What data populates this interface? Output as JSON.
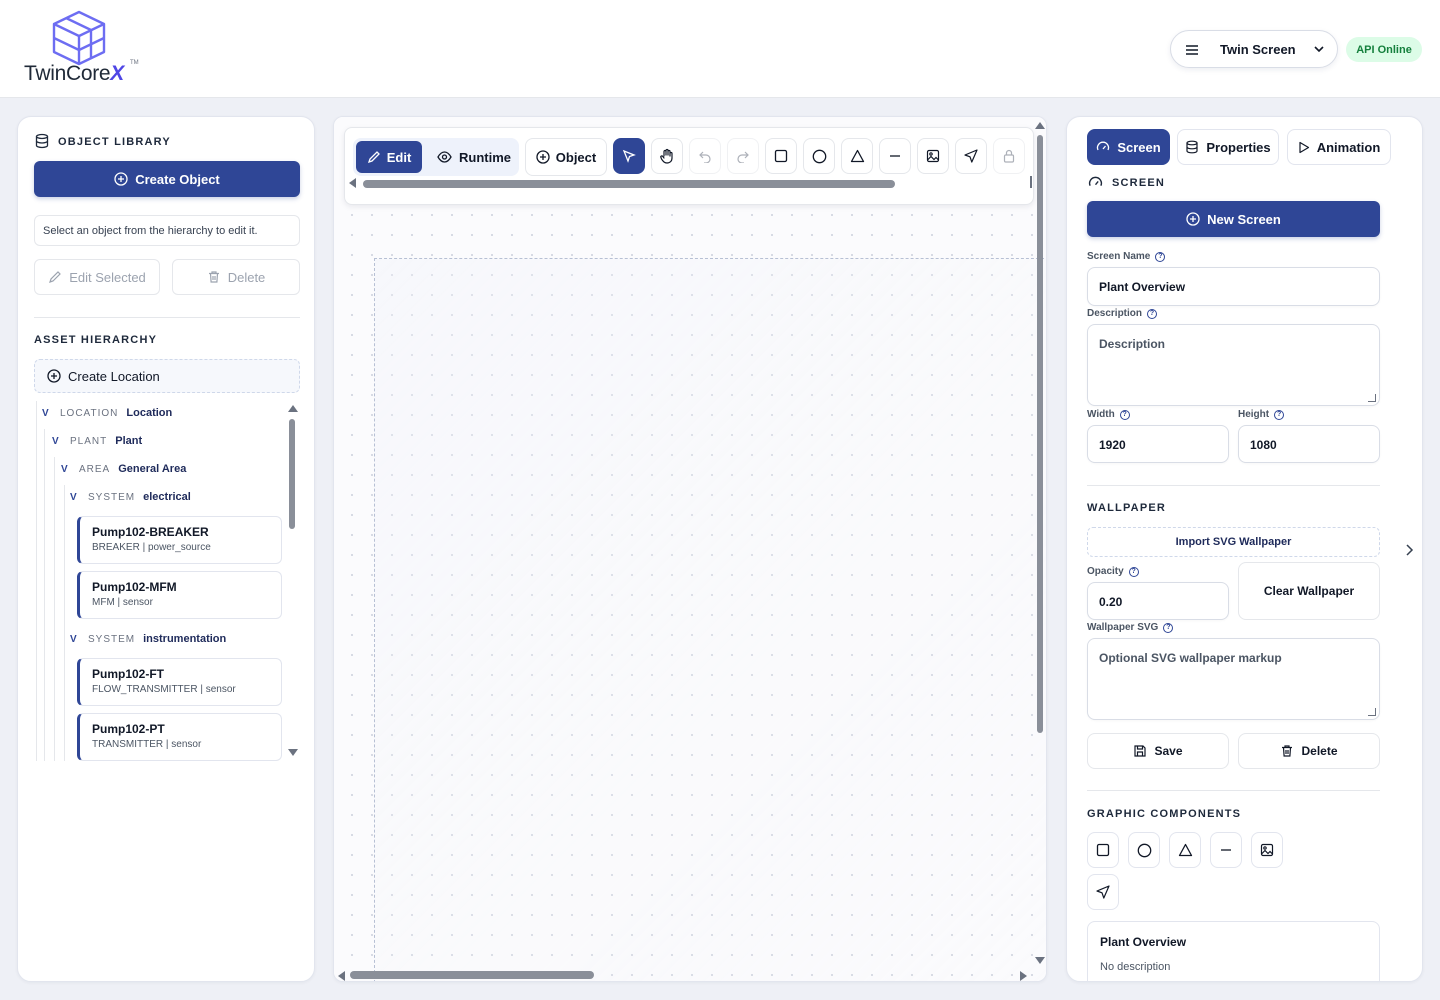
{
  "app": {
    "brand": "TwinCore",
    "brand_x": "X",
    "brand_tm": "TM"
  },
  "header": {
    "screen_selector": "Twin Screen",
    "api_status": "API Online"
  },
  "left": {
    "library_title": "OBJECT LIBRARY",
    "create_object": "Create Object",
    "hint": "Select an object from the hierarchy to edit it.",
    "edit_selected": "Edit Selected",
    "delete": "Delete",
    "hierarchy_title": "ASSET HIERARCHY",
    "create_location": "Create Location",
    "tree": [
      {
        "toggle": "V",
        "kind": "LOCATION",
        "name": "Location"
      },
      {
        "toggle": "V",
        "kind": "PLANT",
        "name": "Plant"
      },
      {
        "toggle": "V",
        "kind": "AREA",
        "name": "General Area"
      },
      {
        "toggle": "V",
        "kind": "SYSTEM",
        "name": "electrical"
      },
      {
        "toggle": "V",
        "kind": "SYSTEM",
        "name": "instrumentation"
      }
    ],
    "assets": [
      {
        "title": "Pump102-BREAKER",
        "sub": "BREAKER | power_source"
      },
      {
        "title": "Pump102-MFM",
        "sub": "MFM | sensor"
      },
      {
        "title": "Pump102-FT",
        "sub": "FLOW_TRANSMITTER | sensor"
      },
      {
        "title": "Pump102-PT",
        "sub": "TRANSMITTER | sensor"
      }
    ]
  },
  "toolbar": {
    "edit": "Edit",
    "runtime": "Runtime",
    "object": "Object"
  },
  "right": {
    "tabs": [
      "Screen",
      "Properties",
      "Animation"
    ],
    "screen_title": "SCREEN",
    "new_screen": "New Screen",
    "screen_name_label": "Screen Name",
    "screen_name": "Plant Overview",
    "description_label": "Description",
    "description_placeholder": "Description",
    "width_label": "Width",
    "width": "1920",
    "height_label": "Height",
    "height": "1080",
    "wallpaper_title": "WALLPAPER",
    "import_wallpaper": "Import SVG Wallpaper",
    "opacity_label": "Opacity",
    "opacity": "0.20",
    "clear_wallpaper": "Clear Wallpaper",
    "wallpaper_svg_label": "Wallpaper SVG",
    "wallpaper_svg_placeholder": "Optional SVG wallpaper markup",
    "save": "Save",
    "delete": "Delete",
    "components_title": "GRAPHIC COMPONENTS",
    "screen_card_title": "Plant Overview",
    "screen_card_sub": "No description"
  },
  "colors": {
    "primary": "#2f4696",
    "api_bg": "#dcfce7",
    "api_text": "#15803d",
    "logo": "#6366f1"
  }
}
